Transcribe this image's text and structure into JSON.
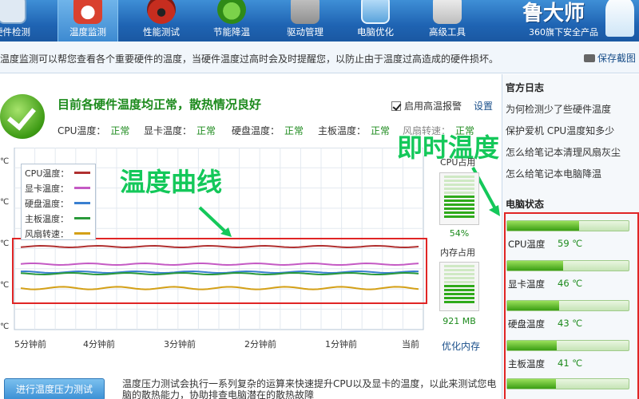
{
  "toolbar": {
    "items": [
      {
        "label": "硬件检测",
        "icon": "hardware-check-icon"
      },
      {
        "label": "温度监测",
        "icon": "thermometer-icon",
        "active": true
      },
      {
        "label": "性能测试",
        "icon": "speedometer-icon"
      },
      {
        "label": "节能降温",
        "icon": "clover-icon"
      },
      {
        "label": "驱动管理",
        "icon": "driver-icon"
      },
      {
        "label": "电脑优化",
        "icon": "monitor-icon"
      },
      {
        "label": "高级工具",
        "icon": "toolbox-icon"
      }
    ],
    "brand": {
      "logo": "鲁大师",
      "sub": "360旗下安全产品"
    }
  },
  "infobar": {
    "text": "温度监测可以帮您查看各个重要硬件的温度，当硬件温度过高时会及时提醒您，以防止由于温度过高造成的硬件损坏。",
    "save_label": "保存截图"
  },
  "status": {
    "title": "目前各硬件温度均正常，散热情况良好",
    "alarm_label": "启用高温报警",
    "alarm_checked": true,
    "settings_label": "设置",
    "readouts": [
      {
        "name": "CPU温度：",
        "value": "正常"
      },
      {
        "name": "显卡温度：",
        "value": "正常"
      },
      {
        "name": "硬盘温度：",
        "value": "正常"
      },
      {
        "name": "主板温度：",
        "value": "正常"
      },
      {
        "name": "风扇转速：",
        "value": "正常"
      }
    ]
  },
  "annotations": {
    "curve": "温度曲线",
    "realtime": "即时温度"
  },
  "chart_data": {
    "type": "line",
    "y_unit": "℃",
    "x_tick_labels": [
      "5分钟前",
      "4分钟前",
      "3分钟前",
      "2分钟前",
      "1分钟前",
      "当前"
    ],
    "legend": [
      {
        "name": "CPU温度：",
        "color": "#b03030"
      },
      {
        "name": "显卡温度：",
        "color": "#c45ac4"
      },
      {
        "name": "硬盘温度：",
        "color": "#3a7fd0"
      },
      {
        "name": "主板温度：",
        "color": "#2a9a3a"
      },
      {
        "name": "风扇转速：",
        "color": "#d4a017"
      }
    ],
    "grid": true
  },
  "meters": {
    "cpu": {
      "title": "CPU占用",
      "value": "54%",
      "level": 0.54
    },
    "memory": {
      "title": "内存占用",
      "value": "921 MB",
      "level": 0.5
    },
    "optimize_label": "优化内存"
  },
  "stress": {
    "button": "进行温度压力测试",
    "desc": "温度压力测试会执行一系列复杂的运算来快速提升CPU以及显卡的温度，以此来测试您电脑的散热能力，协助排查电脑潜在的散热故障"
  },
  "sidebar": {
    "log_title": "官方日志",
    "logs": [
      "为何检测少了些硬件温度",
      "保护爱机 CPU温度知多少",
      "怎么给笔记本清理风扇灰尘",
      "怎么给笔记本电脑降温"
    ],
    "state_title": "电脑状态",
    "states": [
      {
        "name": "CPU温度",
        "value": "59 ℃",
        "level": 0.59
      },
      {
        "name": "显卡温度",
        "value": "46 ℃",
        "level": 0.46
      },
      {
        "name": "硬盘温度",
        "value": "43 ℃",
        "level": 0.43
      },
      {
        "name": "主板温度",
        "value": "41 ℃",
        "level": 0.41
      }
    ]
  }
}
